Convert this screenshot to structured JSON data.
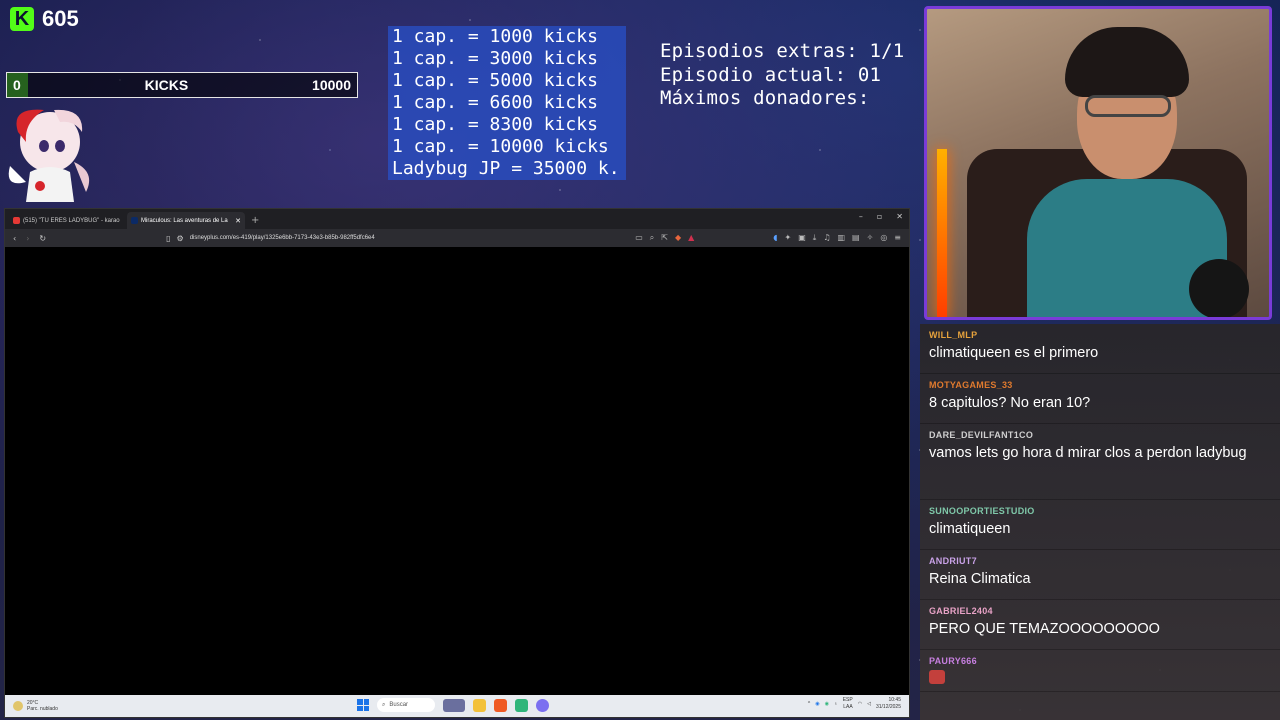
{
  "kick": {
    "count": "605",
    "bar_min": "0",
    "bar_label": "KICKS",
    "bar_max": "10000",
    "progress_fraction": 0.06,
    "logo_letter": "K",
    "brand_color": "#53fc18"
  },
  "goals": [
    "1 cap. = 1000 kicks",
    "1 cap. = 3000 kicks",
    "1 cap. = 5000 kicks",
    "1 cap. = 6600 kicks",
    "1 cap. = 8300 kicks",
    "1 cap. = 10000 kicks",
    "Ladybug JP = 35000 k."
  ],
  "episodes": {
    "extras": "Episodios extras: 1/1",
    "current": "Episodio actual: 01",
    "donors": "Máximos donadores:"
  },
  "browser": {
    "tabs": [
      {
        "label": "(515) \"TU ERES LADYBUG\" - karao",
        "favicon_color": "#e53935",
        "active": false
      },
      {
        "label": "Miraculous: Las aventuras de La",
        "favicon_color": "#0b2a66",
        "active": true
      }
    ],
    "new_tab": "+",
    "url": "disneyplus.com/es-419/play/1325e6bb-7173-43e3-b85b-982ff5dfc6e4",
    "window_controls": [
      "–",
      "▫",
      "✕"
    ]
  },
  "taskbar": {
    "weather_temp": "20°C",
    "weather_desc": "Parc. nublado",
    "search_placeholder": "Buscar",
    "lang_top": "ESP",
    "lang_bottom": "LAA",
    "time": "10:45",
    "date": "31/12/2025"
  },
  "chat": [
    {
      "user": "WILL_MLP",
      "text": "climatiqueen es el primero",
      "color": "#e6a23c"
    },
    {
      "user": "MOTYAGAMES_33",
      "text": "8 capitulos? No eran 10?",
      "color": "#e07a2e"
    },
    {
      "user": "DARE_DEVILFANT1CO",
      "text": "vamos lets go hora d mirar clos a perdon ladybug",
      "color": "#cfcfcf"
    },
    {
      "user": "SUNOOPORTIESTUDIO",
      "text": "climatiqueen",
      "color": "#7fc8a9"
    },
    {
      "user": "ANDRIUT7",
      "text": "Reina Climatica",
      "color": "#c9a2e8"
    },
    {
      "user": "GABRIEL2404",
      "text": "PERO QUE TEMAZOOOOOOOOO",
      "color": "#e9a3c7"
    },
    {
      "user": "PAURY666",
      "text": "",
      "color": "#c77fe0"
    }
  ]
}
